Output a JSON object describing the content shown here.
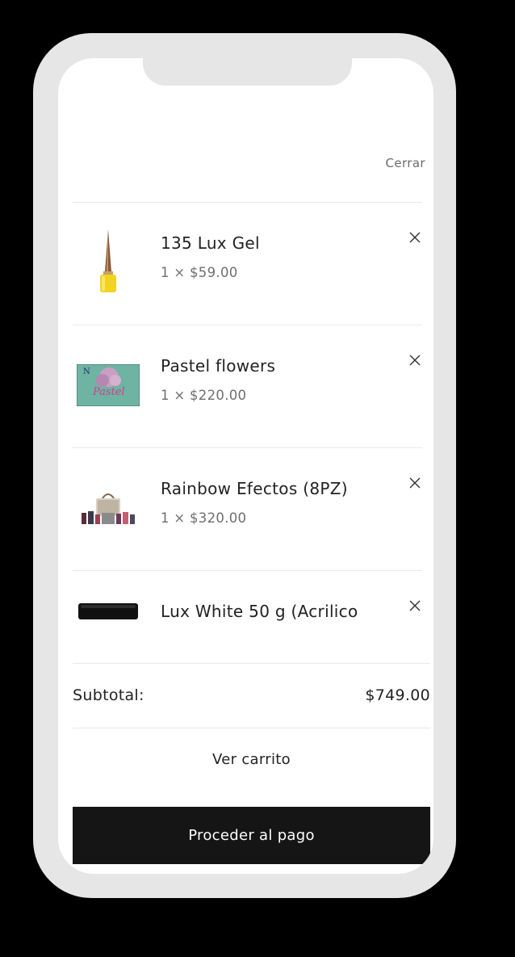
{
  "header": {
    "close_label": "Cerrar"
  },
  "cart": {
    "items": [
      {
        "name": "135 Lux Gel",
        "price": "1 × $59.00",
        "image_icon": "nail-polish-bottle-icon"
      },
      {
        "name": "Pastel flowers",
        "price": "1 × $220.00",
        "image_icon": "pastel-flowers-box-icon"
      },
      {
        "name": "Rainbow Efectos (8PZ)",
        "price": "1 × $320.00",
        "image_icon": "effects-kit-icon"
      },
      {
        "name": "Lux White 50 g (Acrilico",
        "price": "",
        "image_icon": "acrylic-jar-icon"
      }
    ],
    "remove_icon": "close-icon"
  },
  "summary": {
    "subtotal_label": "Subtotal:",
    "subtotal_value": "$749.00"
  },
  "actions": {
    "view_cart_label": "Ver carrito",
    "checkout_label": "Proceder al pago"
  },
  "colors": {
    "background": "#000000",
    "frame": "#e6e6e6",
    "screen": "#ffffff",
    "checkout_button": "#151515",
    "text_primary": "#222222",
    "text_muted": "#6e6e6e"
  }
}
